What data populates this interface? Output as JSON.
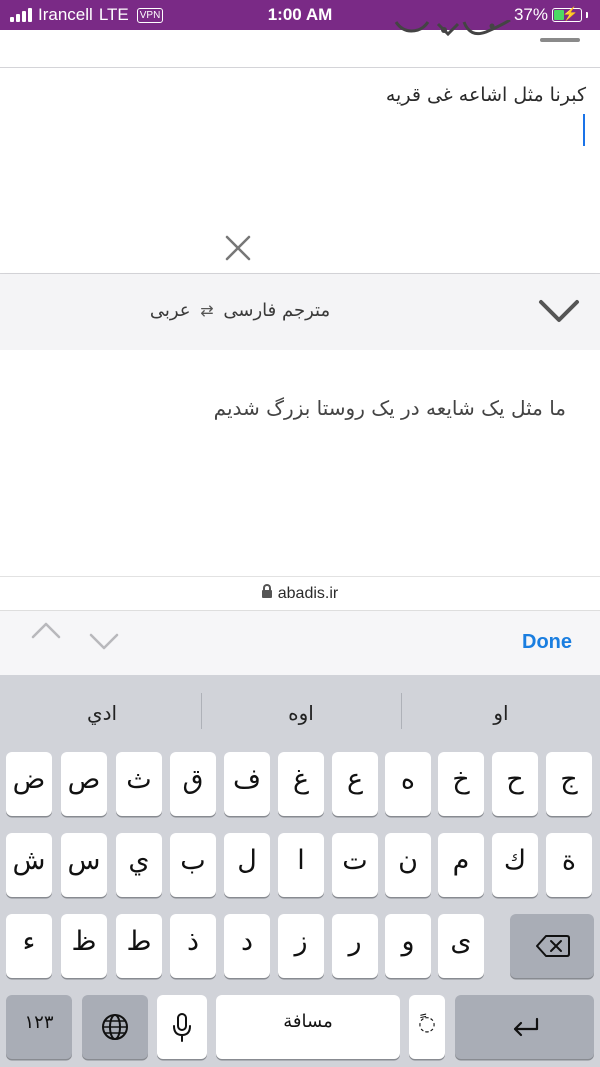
{
  "status_bar": {
    "carrier": "Irancell",
    "network": "LTE",
    "vpn": "VPN",
    "time": "1:00 AM",
    "battery_percent": "37%",
    "battery_level": 0.37
  },
  "translator": {
    "input_text": "کبرنا مثل اشاعه غی قریه",
    "language_pair": {
      "title": "مترجم",
      "source": "فارسی",
      "swap_icon": "swap-arrows-icon",
      "target": "عربی"
    },
    "result_text": "ما مثل یک شایعه در یک روستا بزرگ شدیم"
  },
  "browser": {
    "url": "abadis.ir"
  },
  "accessory": {
    "done_label": "Done"
  },
  "keyboard": {
    "suggestions": [
      "ادي",
      "اوه",
      "او"
    ],
    "rows": [
      [
        "ض",
        "ص",
        "ث",
        "ق",
        "ف",
        "غ",
        "ع",
        "ه",
        "خ",
        "ح",
        "ج"
      ],
      [
        "ش",
        "س",
        "ي",
        "ب",
        "ل",
        "ا",
        "ت",
        "ن",
        "م",
        "ك",
        "ة"
      ],
      [
        "ء",
        "ظ",
        "ط",
        "ذ",
        "د",
        "ز",
        "ر",
        "و",
        "ى"
      ]
    ],
    "numbers_label": "١٢٣",
    "space_label": "مسافة",
    "diacritic_label": "ً◌",
    "colors": {
      "background": "#d1d3d9",
      "key": "#ffffff",
      "dark_key": "#a9adb6"
    }
  },
  "colors": {
    "status_bar": "#7a2a86",
    "accent": "#1a7ee0",
    "caret": "#1a73e8"
  }
}
